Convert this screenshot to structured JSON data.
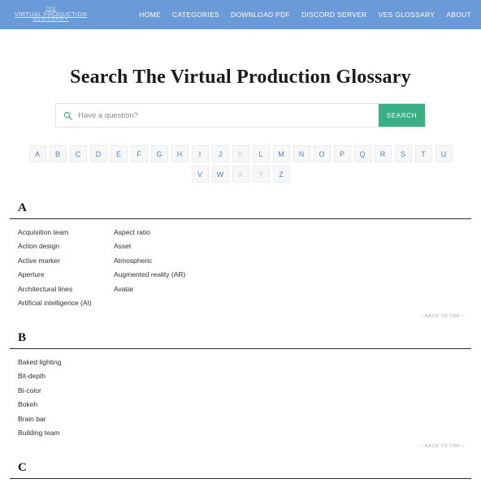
{
  "header": {
    "brand": {
      "line1": "THE",
      "line2": "VIRTUAL PRODUCTION",
      "line3": "GLOSSARY"
    },
    "nav_items": [
      {
        "label": "HOME"
      },
      {
        "label": "CATEGORIES"
      },
      {
        "label": "DOWNLOAD PDF"
      },
      {
        "label": "DISCORD SERVER"
      },
      {
        "label": "VES GLOSSARY"
      },
      {
        "label": "ABOUT"
      }
    ],
    "background_color": "#6b9ad8"
  },
  "main": {
    "page_title": "Search The Virtual Production Glossary",
    "search": {
      "icon": "search-icon",
      "placeholder": "Have a question?",
      "value": "",
      "button_label": "SEARCH",
      "button_color": "#3aaf86",
      "icon_color": "#3aaf86"
    },
    "alphabet": {
      "letters": [
        {
          "label": "A",
          "enabled": true
        },
        {
          "label": "B",
          "enabled": true
        },
        {
          "label": "C",
          "enabled": true
        },
        {
          "label": "D",
          "enabled": true
        },
        {
          "label": "E",
          "enabled": true
        },
        {
          "label": "F",
          "enabled": true
        },
        {
          "label": "G",
          "enabled": true
        },
        {
          "label": "H",
          "enabled": true
        },
        {
          "label": "I",
          "enabled": true
        },
        {
          "label": "J",
          "enabled": true
        },
        {
          "label": "K",
          "enabled": false
        },
        {
          "label": "L",
          "enabled": true
        },
        {
          "label": "M",
          "enabled": true
        },
        {
          "label": "N",
          "enabled": true
        },
        {
          "label": "O",
          "enabled": true
        },
        {
          "label": "P",
          "enabled": true
        },
        {
          "label": "Q",
          "enabled": true
        },
        {
          "label": "R",
          "enabled": true
        },
        {
          "label": "S",
          "enabled": true
        },
        {
          "label": "T",
          "enabled": true
        },
        {
          "label": "U",
          "enabled": true
        },
        {
          "label": "V",
          "enabled": true
        },
        {
          "label": "W",
          "enabled": true
        },
        {
          "label": "X",
          "enabled": false
        },
        {
          "label": "Y",
          "enabled": false
        },
        {
          "label": "Z",
          "enabled": true
        }
      ]
    },
    "back_to_top_label": "~ BACK TO TOP ~",
    "sections": [
      {
        "letter": "A",
        "columns": [
          [
            "Acquisition team",
            "Action design",
            "Active marker",
            "Aperture",
            "Architectural lines",
            "Artificial intelligence (AI)"
          ],
          [
            "Aspect ratio",
            "Asset",
            "Atmospheric",
            "Augmented reality (AR)",
            "Avatar"
          ]
        ]
      },
      {
        "letter": "B",
        "columns": [
          [
            "Baked lighting",
            "Bit-depth",
            "Bi-color",
            "Bokeh",
            "Brain bar",
            "Building team"
          ],
          []
        ]
      },
      {
        "letter": "C",
        "columns": [
          [],
          []
        ]
      }
    ]
  }
}
